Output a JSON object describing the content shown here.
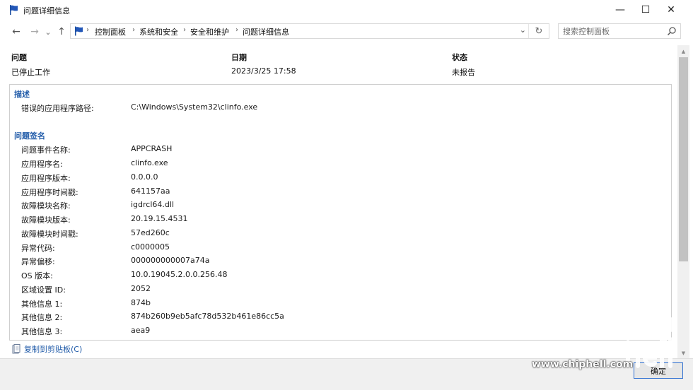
{
  "window": {
    "title": "问题详细信息",
    "icon": "flag-icon",
    "controls": {
      "minimize": "—",
      "maximize": "☐",
      "close": "✕"
    }
  },
  "nav": {
    "back": "←",
    "forward": "→",
    "recent": "⌄",
    "up": "↑",
    "breadcrumb": [
      "控制面板",
      "系统和安全",
      "安全和维护",
      "问题详细信息"
    ],
    "separator": "›",
    "dropdown": "⌄",
    "refresh": "↻"
  },
  "search": {
    "placeholder": "搜索控制面板"
  },
  "summary": {
    "headers": {
      "problem": "问题",
      "date": "日期",
      "status": "状态"
    },
    "values": {
      "problem": "已停止工作",
      "date": "2023/3/25 17:58",
      "status": "未报告"
    }
  },
  "details": {
    "description": {
      "title": "描述",
      "rows": [
        {
          "label": "错误的应用程序路径:",
          "value": "C:\\Windows\\System32\\clinfo.exe"
        }
      ]
    },
    "signature": {
      "title": "问题签名",
      "rows": [
        {
          "label": "问题事件名称:",
          "value": "APPCRASH"
        },
        {
          "label": "应用程序名:",
          "value": "clinfo.exe"
        },
        {
          "label": "应用程序版本:",
          "value": "0.0.0.0"
        },
        {
          "label": "应用程序时间戳:",
          "value": "641157aa"
        },
        {
          "label": "故障模块名称:",
          "value": "igdrcl64.dll"
        },
        {
          "label": "故障模块版本:",
          "value": "20.19.15.4531"
        },
        {
          "label": "故障模块时间戳:",
          "value": "57ed260c"
        },
        {
          "label": "异常代码:",
          "value": "c0000005"
        },
        {
          "label": "异常偏移:",
          "value": "000000000007a74a"
        },
        {
          "label": "OS 版本:",
          "value": "10.0.19045.2.0.0.256.48"
        },
        {
          "label": "区域设置 ID:",
          "value": "2052"
        },
        {
          "label": "其他信息 1:",
          "value": "874b"
        },
        {
          "label": "其他信息 2:",
          "value": "874b260b9eb5afc78d532b461e86cc5a"
        },
        {
          "label": "其他信息 3:",
          "value": "aea9"
        }
      ]
    }
  },
  "footer": {
    "copy_link": "复制到剪贴板(C)",
    "ok_button": "确定"
  },
  "watermark": {
    "url": "www.chiphell.com"
  },
  "colors": {
    "link": "#1f5aa8",
    "accent": "#2f6fd1"
  }
}
